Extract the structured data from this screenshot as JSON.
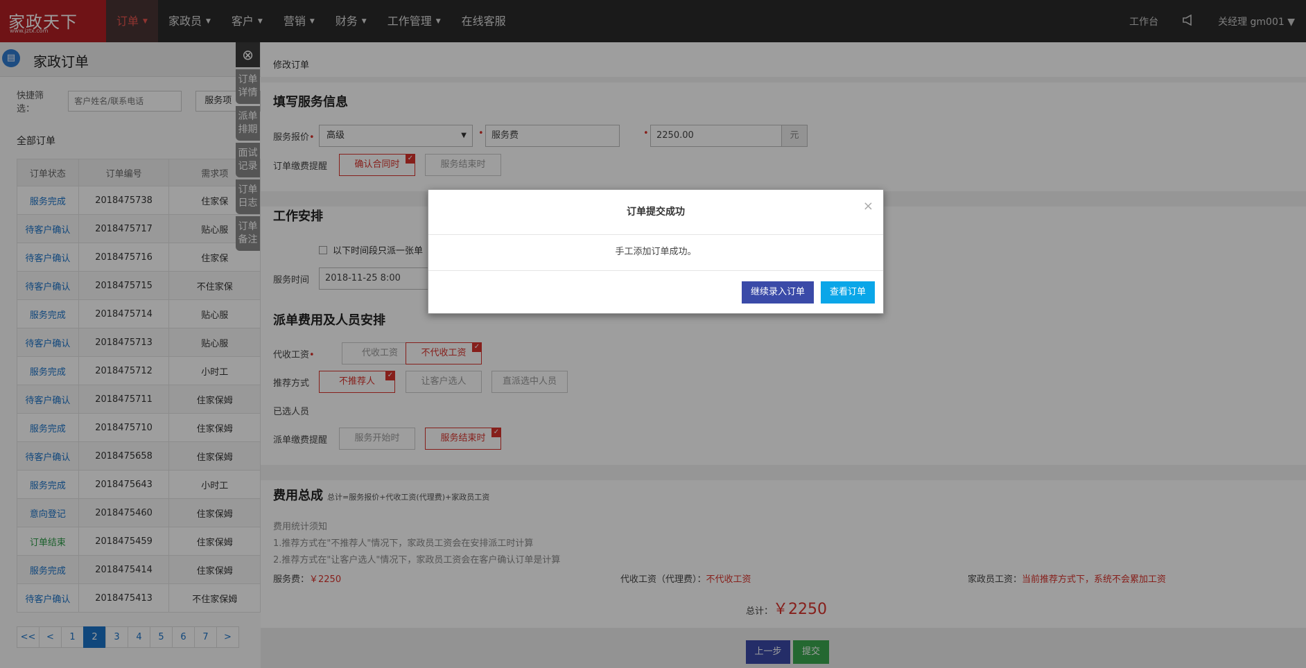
{
  "logo": {
    "text": "家政天下",
    "url": "www.jztx.com"
  },
  "nav": [
    {
      "label": "订单",
      "caret": "▼"
    },
    {
      "label": "家政员",
      "caret": "▼"
    },
    {
      "label": "客户",
      "caret": "▼"
    },
    {
      "label": "营销",
      "caret": "▼"
    },
    {
      "label": "财务",
      "caret": "▼"
    },
    {
      "label": "工作管理",
      "caret": "▼"
    },
    {
      "label": "在线客服",
      "caret": ""
    }
  ],
  "top_right": {
    "workbench": "工作台",
    "user": "关经理 gm001 ▼"
  },
  "left": {
    "title": "家政订单",
    "quick_label": "快捷筛选：",
    "search_placeholder": "客户姓名/联系电话",
    "service_filter": "服务项",
    "all_orders": "全部订单",
    "columns": [
      "订单状态",
      "订单编号",
      "需求项"
    ],
    "rows": [
      {
        "status": "服务完成",
        "id": "2018475738",
        "item": "住家保"
      },
      {
        "status": "待客户确认",
        "id": "2018475717",
        "item": "贴心服"
      },
      {
        "status": "待客户确认",
        "id": "2018475716",
        "item": "住家保"
      },
      {
        "status": "待客户确认",
        "id": "2018475715",
        "item": "不住家保"
      },
      {
        "status": "服务完成",
        "id": "2018475714",
        "item": "贴心服"
      },
      {
        "status": "待客户确认",
        "id": "2018475713",
        "item": "贴心服"
      },
      {
        "status": "服务完成",
        "id": "2018475712",
        "item": "小时工"
      },
      {
        "status": "待客户确认",
        "id": "2018475711",
        "item": "住家保姆"
      },
      {
        "status": "服务完成",
        "id": "2018475710",
        "item": "住家保姆"
      },
      {
        "status": "待客户确认",
        "id": "2018475658",
        "item": "住家保姆"
      },
      {
        "status": "服务完成",
        "id": "2018475643",
        "item": "小时工"
      },
      {
        "status": "意向登记",
        "id": "2018475460",
        "item": "住家保姆"
      },
      {
        "status": "订单结束",
        "id": "2018475459",
        "item": "住家保姆"
      },
      {
        "status": "服务完成",
        "id": "2018475414",
        "item": "住家保姆"
      },
      {
        "status": "待客户确认",
        "id": "2018475413",
        "item": "不住家保姆"
      }
    ],
    "pager": [
      "<<",
      "<",
      "1",
      "2",
      "3",
      "4",
      "5",
      "6",
      "7",
      ">"
    ],
    "current_page": "2"
  },
  "side_tabs": [
    "订单详情",
    "派单排期",
    "面试记录",
    "订单日志",
    "订单备注"
  ],
  "form": {
    "breadcrumb": "修改订单",
    "sec1": "填写服务信息",
    "quote_label": "服务报价",
    "level": "高级",
    "fee_name": "服务费",
    "fee_value": "2250.00",
    "unit": "元",
    "remind_label": "订单缴费提醒",
    "remind_opts": [
      "确认合同时",
      "服务结束时"
    ],
    "sec2": "工作安排",
    "only_one": "以下时间段只派一张单",
    "time_label": "服务时间",
    "time_value": "2018-11-25 8:00",
    "sec3": "派单费用及人员安排",
    "wage_label": "代收工资",
    "wage_opts": [
      "代收工资",
      "不代收工资"
    ],
    "recommend_label": "推荐方式",
    "recommend_opts": [
      "不推荐人",
      "让客户选人",
      "直派选中人员"
    ],
    "selected_label": "已选人员",
    "dispatch_remind_label": "派单缴费提醒",
    "dispatch_remind_opts": [
      "服务开始时",
      "服务结束时"
    ],
    "sec4": "费用总成",
    "sec4_formula": "总计=服务报价+代收工资(代理费)+家政员工资",
    "notes_title": "费用统计须知",
    "note1": "1.推荐方式在\"不推荐人\"情况下，家政员工资会在安排派工时计算",
    "note2": "2.推荐方式在\"让客户选人\"情况下，家政员工资会在客户确认订单是计算",
    "fee_label": "服务费：",
    "fee_amount": "￥2250",
    "agent_label": "代收工资（代理费）：",
    "agent_value": "不代收工资",
    "worker_label": "家政员工资：",
    "worker_value": "当前推荐方式下，系统不会累加工资",
    "total_label": "总计：",
    "total_value": "￥2250",
    "prev": "上一步",
    "submit": "提交"
  },
  "modal": {
    "title": "订单提交成功",
    "message": "手工添加订单成功。",
    "continue": "继续录入订单",
    "view": "查看订单"
  },
  "colors": {
    "brand": "#b41f24",
    "link": "#1b73c9",
    "accent_red": "#d9332c",
    "btn_indigo": "#3a4aa8",
    "btn_cyan": "#0aa6e8",
    "btn_green": "#3aa850"
  }
}
